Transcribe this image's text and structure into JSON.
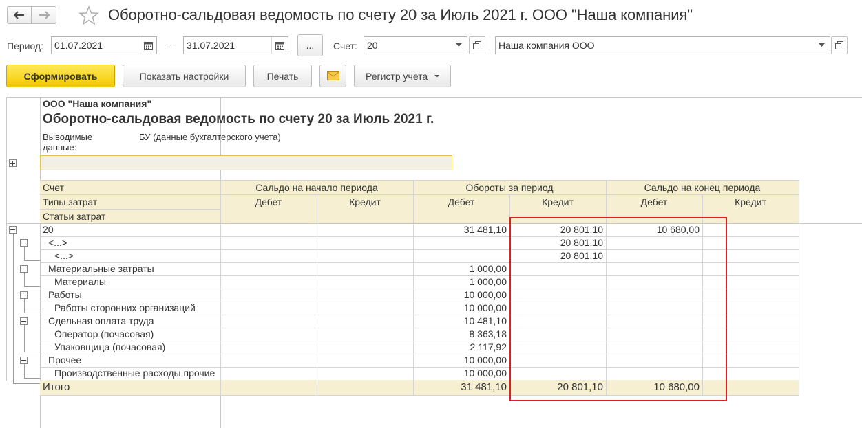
{
  "window": {
    "title": "Оборотно-сальдовая ведомость по счету 20 за Июль 2021 г. ООО \"Наша компания\""
  },
  "params": {
    "period_label": "Период:",
    "date_from": "01.07.2021",
    "date_sep": "–",
    "date_to": "31.07.2021",
    "dots_label": "...",
    "account_label": "Счет:",
    "account_value": "20",
    "company_value": "Наша компания ООО"
  },
  "toolbar": {
    "generate_label": "Сформировать",
    "settings_label": "Показать настройки",
    "print_label": "Печать",
    "register_label": "Регистр учета"
  },
  "report": {
    "org": "ООО \"Наша компания\"",
    "title": "Оборотно-сальдовая ведомость по счету 20 за Июль 2021 г.",
    "output_label": "Выводимые данные:",
    "output_value": "БУ (данные бухгалтерского учета)",
    "col_account": "Счет",
    "col_cost_types": "Типы затрат",
    "col_cost_items": "Статьи затрат",
    "grp_opening": "Сальдо на начало периода",
    "grp_turnover": "Обороты за период",
    "grp_closing": "Сальдо на конец периода",
    "debit": "Дебет",
    "credit": "Кредит",
    "rows": [
      {
        "name": "20",
        "level": 0,
        "od": "",
        "oc": "",
        "td": "31 481,10",
        "tc": "20 801,10",
        "cd": "10 680,00",
        "cc": ""
      },
      {
        "name": "<...>",
        "level": 1,
        "od": "",
        "oc": "",
        "td": "",
        "tc": "20 801,10",
        "cd": "",
        "cc": ""
      },
      {
        "name": "<...>",
        "level": 2,
        "od": "",
        "oc": "",
        "td": "",
        "tc": "20 801,10",
        "cd": "",
        "cc": ""
      },
      {
        "name": "Материальные затраты",
        "level": 1,
        "od": "",
        "oc": "",
        "td": "1 000,00",
        "tc": "",
        "cd": "",
        "cc": ""
      },
      {
        "name": "Материалы",
        "level": 2,
        "od": "",
        "oc": "",
        "td": "1 000,00",
        "tc": "",
        "cd": "",
        "cc": ""
      },
      {
        "name": "Работы",
        "level": 1,
        "od": "",
        "oc": "",
        "td": "10 000,00",
        "tc": "",
        "cd": "",
        "cc": ""
      },
      {
        "name": "Работы сторонних организаций",
        "level": 2,
        "od": "",
        "oc": "",
        "td": "10 000,00",
        "tc": "",
        "cd": "",
        "cc": ""
      },
      {
        "name": "Сдельная оплата труда",
        "level": 1,
        "od": "",
        "oc": "",
        "td": "10 481,10",
        "tc": "",
        "cd": "",
        "cc": ""
      },
      {
        "name": "Оператор (почасовая)",
        "level": 2,
        "od": "",
        "oc": "",
        "td": "8 363,18",
        "tc": "",
        "cd": "",
        "cc": ""
      },
      {
        "name": "Упаковщица (почасовая)",
        "level": 2,
        "od": "",
        "oc": "",
        "td": "2 117,92",
        "tc": "",
        "cd": "",
        "cc": ""
      },
      {
        "name": "Прочее",
        "level": 1,
        "od": "",
        "oc": "",
        "td": "10 000,00",
        "tc": "",
        "cd": "",
        "cc": ""
      },
      {
        "name": "Производственные расходы прочие",
        "level": 2,
        "od": "",
        "oc": "",
        "td": "10 000,00",
        "tc": "",
        "cd": "",
        "cc": ""
      }
    ],
    "total": {
      "name": "Итого",
      "od": "",
      "oc": "",
      "td": "31 481,10",
      "tc": "20 801,10",
      "cd": "10 680,00",
      "cc": ""
    }
  },
  "colors": {
    "header_bg": "#f6efd1",
    "primary_button": "#f5cd00",
    "highlight": "#e02020"
  }
}
